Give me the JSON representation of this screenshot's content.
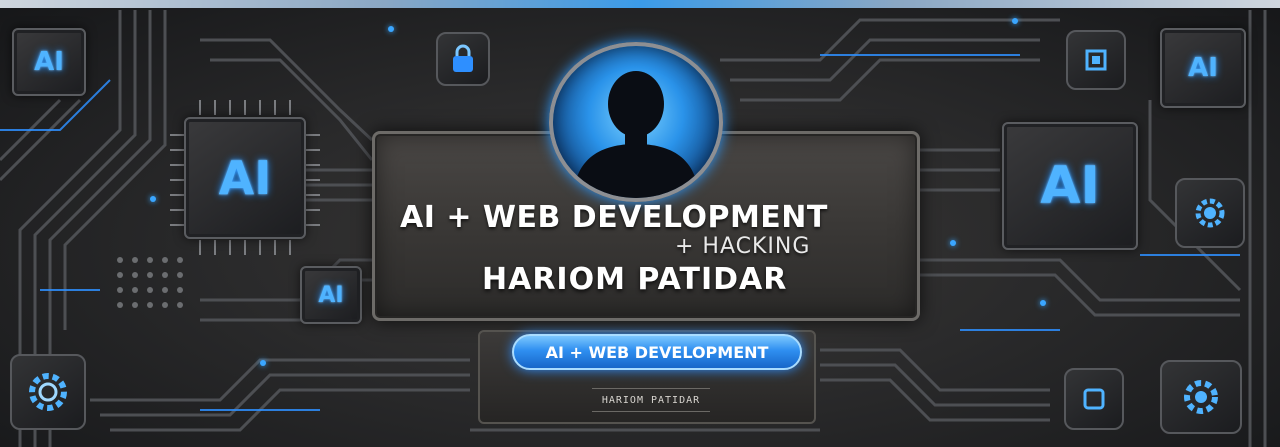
{
  "chips": {
    "left_top": "AI",
    "left_main": "AI",
    "left_small": "AI",
    "right_top": "AI",
    "right_main": "AI"
  },
  "headline": "AI + WEB DEVELOPMENT",
  "subline": "+ HACKING",
  "name": "HARIOM PATIDAR",
  "button_label": "AI + WEB DEVELOPMENT",
  "name_small": "HARIOM PATIDAR",
  "icons": [
    "circuit-board-icon",
    "gear-icon",
    "lock-icon",
    "person-silhouette-icon"
  ],
  "colors": {
    "accent": "#2f8ff0",
    "glow": "#4fb3ff",
    "panel": "#3a3836"
  }
}
